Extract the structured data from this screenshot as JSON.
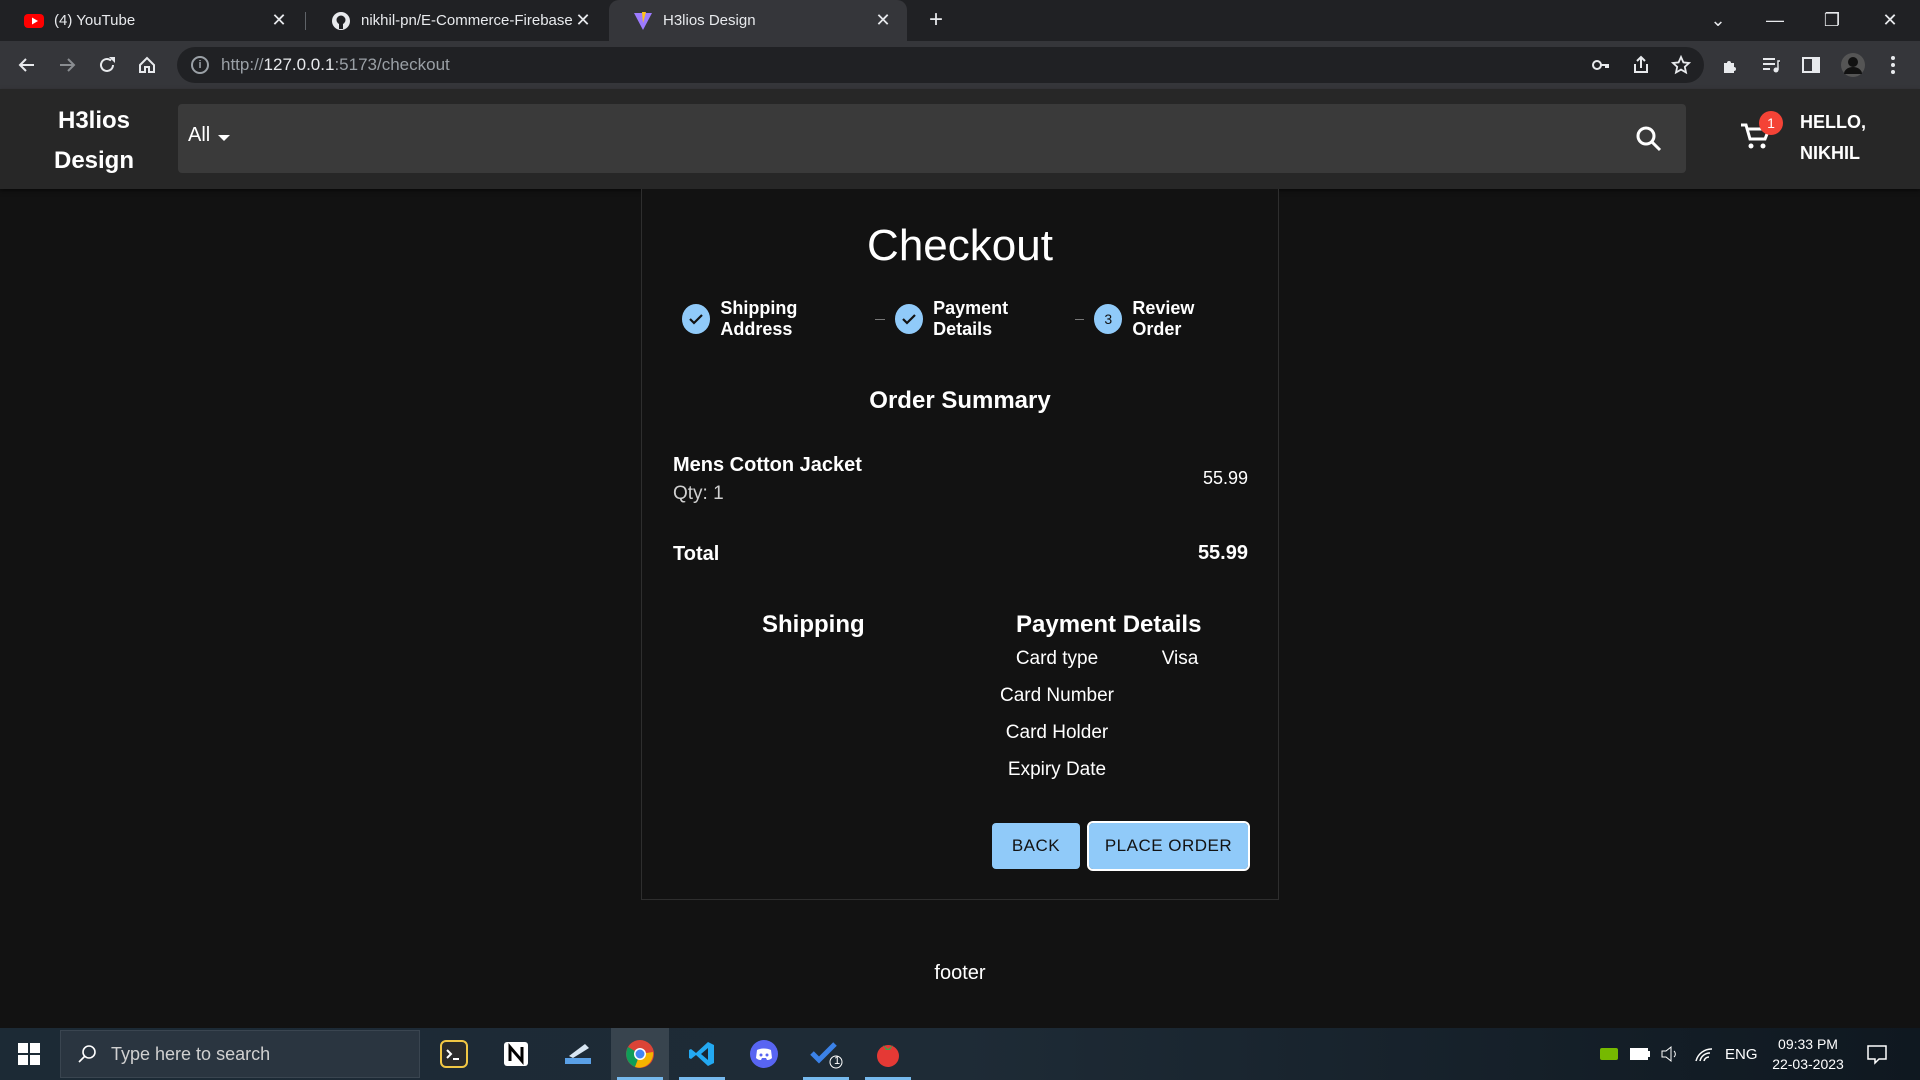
{
  "browser": {
    "tabs": [
      {
        "title": "(4) YouTube",
        "icon": "youtube-icon"
      },
      {
        "title": "nikhil-pn/E-Commerce-Firebase-",
        "icon": "github-icon"
      },
      {
        "title": "H3lios Design",
        "icon": "vite-icon"
      }
    ],
    "url_prefix": "http://",
    "url_host": "127.0.0.1",
    "url_rest": ":5173/checkout"
  },
  "header": {
    "brand_line1": "H3lios",
    "brand_line2": "Design",
    "category": "All",
    "cart_count": "1",
    "greeting_line1": "HELLO,",
    "greeting_line2": "NIKHIL"
  },
  "checkout": {
    "title": "Checkout",
    "steps": [
      {
        "label": "Shipping Address",
        "state": "done"
      },
      {
        "label": "Payment Details",
        "state": "done"
      },
      {
        "label": "Review Order",
        "state": "active",
        "number": "3"
      }
    ],
    "summary_title": "Order Summary",
    "item": {
      "name": "Mens Cotton Jacket",
      "qty": "Qty: 1",
      "price": "55.99"
    },
    "total_label": "Total",
    "total_value": "55.99",
    "shipping_title": "Shipping",
    "payment_title": "Payment Details",
    "payment_rows": [
      {
        "label": "Card type",
        "value": "Visa"
      },
      {
        "label": "Card Number",
        "value": ""
      },
      {
        "label": "Card Holder",
        "value": ""
      },
      {
        "label": "Expiry Date",
        "value": ""
      }
    ],
    "back_label": "BACK",
    "place_order_label": "PLACE ORDER"
  },
  "footer": {
    "text": "footer"
  },
  "taskbar": {
    "search_placeholder": "Type here to search",
    "language": "ENG",
    "time": "09:33 PM",
    "date": "22-03-2023",
    "todo_badge": "1"
  },
  "colors": {
    "accent": "#90caf9",
    "badge": "#f44336",
    "background": "#121212",
    "appbar": "#272727"
  }
}
